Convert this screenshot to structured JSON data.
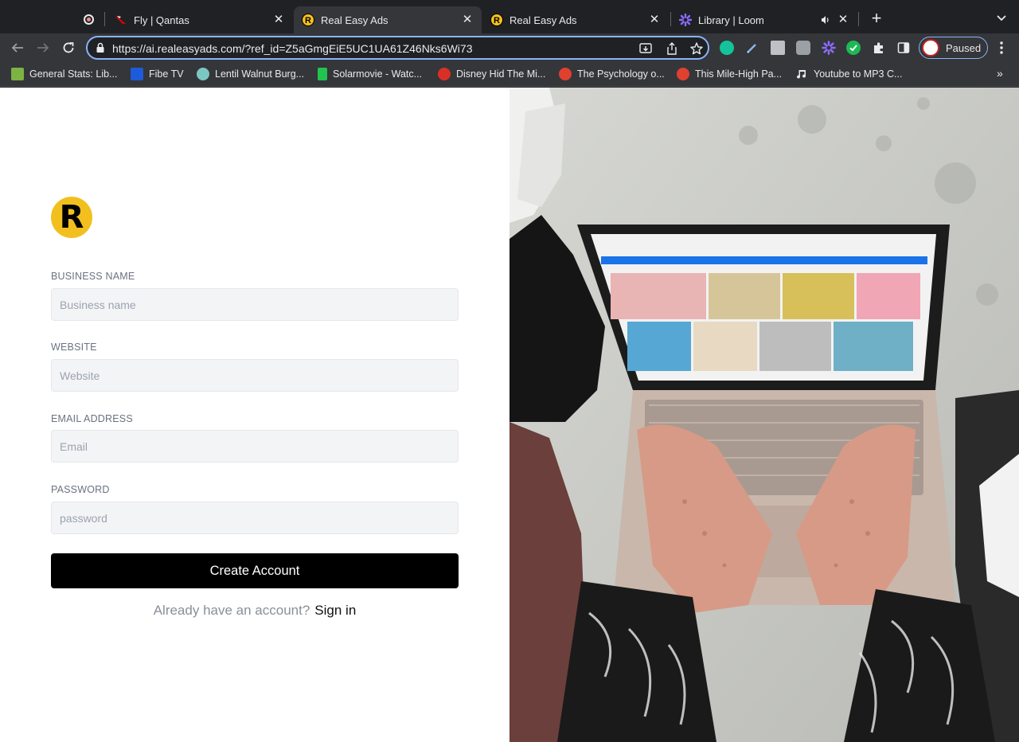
{
  "browser": {
    "tabs": [
      {
        "title": "Fly | Qantas",
        "active": false
      },
      {
        "title": "Real Easy Ads",
        "active": true
      },
      {
        "title": "Real Easy Ads",
        "active": false
      },
      {
        "title": "Library | Loom",
        "active": false
      }
    ],
    "url": "https://ai.realeasyads.com/?ref_id=Z5aGmgEiE5UC1UA61Z46Nks6Wi73",
    "profile_status": "Paused",
    "bookmarks": [
      "General Stats: Lib...",
      "Fibe TV",
      "Lentil Walnut Burg...",
      "Solarmovie - Watc...",
      "Disney Hid The Mi...",
      "The Psychology o...",
      "This Mile-High Pa...",
      "Youtube to MP3 C..."
    ],
    "bookmarks_overflow": "»",
    "colors": {
      "accent": "#8ab4f8",
      "tab_bg": "#202124",
      "toolbar_bg": "#35363a"
    }
  },
  "form": {
    "logo_letter": "R",
    "business_name": {
      "label": "BUSINESS NAME",
      "placeholder": "Business name"
    },
    "website": {
      "label": "WEBSITE",
      "placeholder": "Website"
    },
    "email": {
      "label": "EMAIL ADDRESS",
      "placeholder": "Email"
    },
    "password": {
      "label": "PASSWORD",
      "placeholder": "password"
    },
    "submit_label": "Create Account",
    "signin_prompt": "Already have an account?",
    "signin_link": "Sign in",
    "colors": {
      "brand_yellow": "#f2c01e",
      "button": "#000000"
    }
  }
}
